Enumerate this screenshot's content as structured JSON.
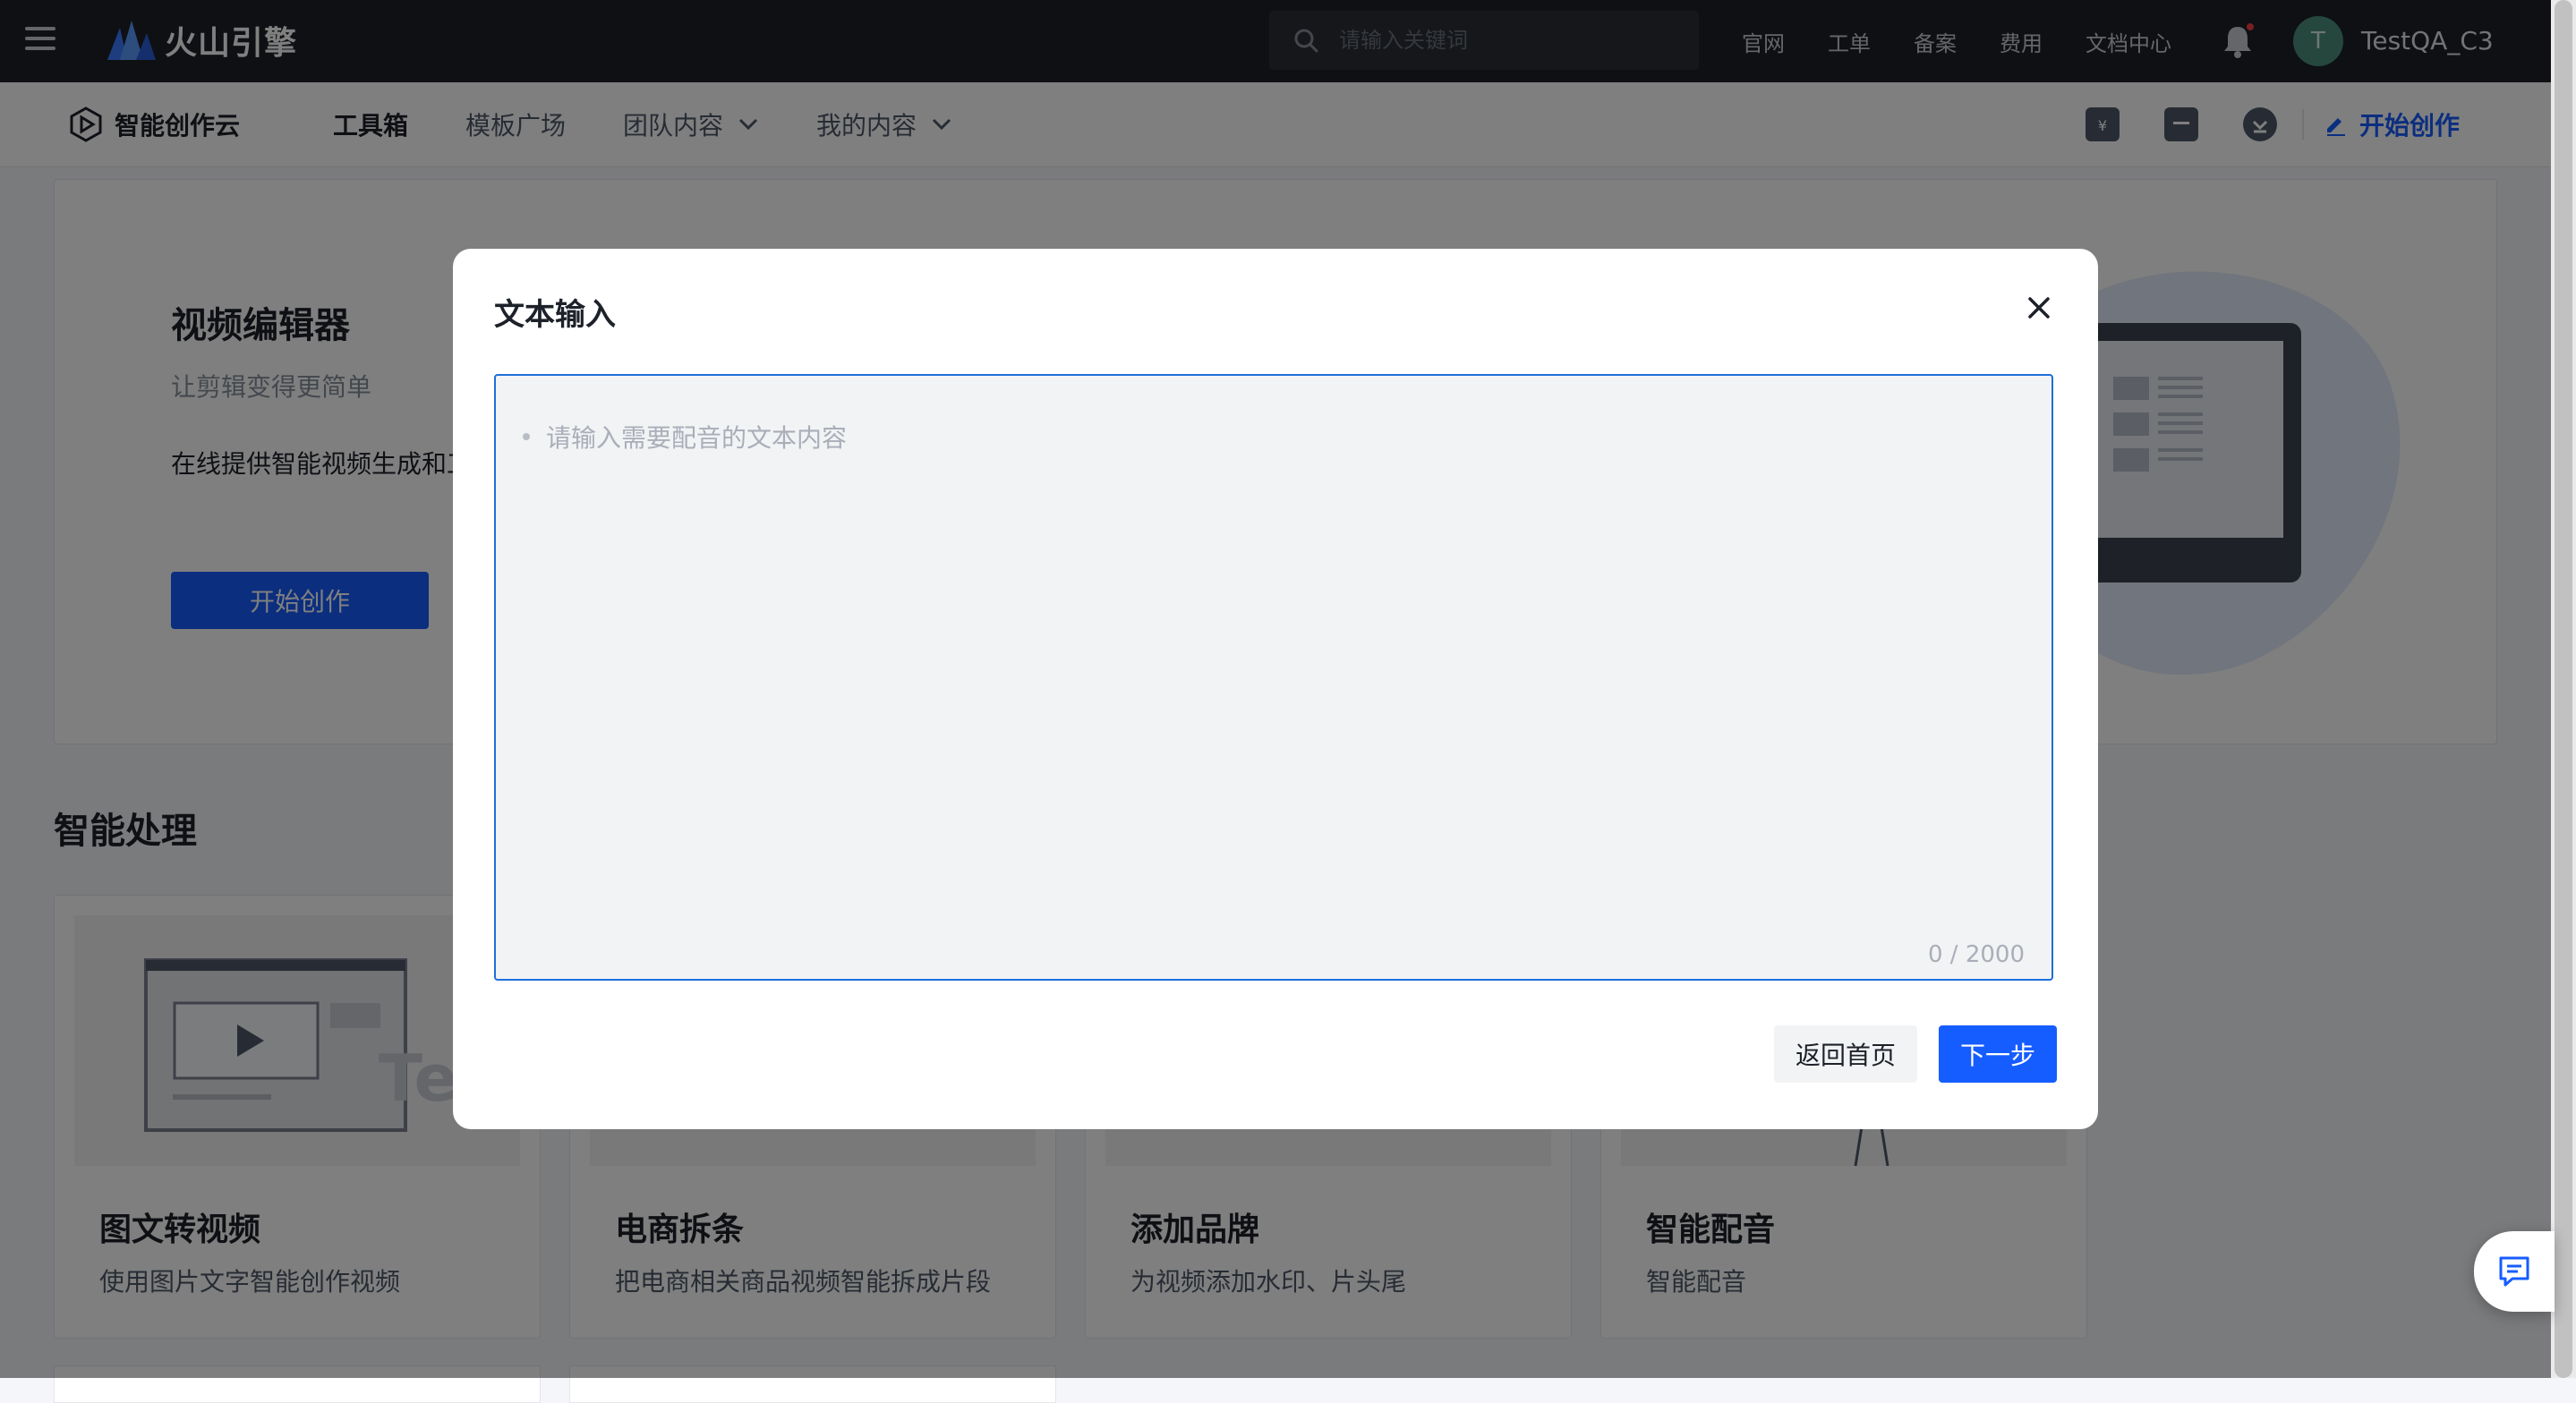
{
  "topbar": {
    "brand": "火山引擎",
    "search_placeholder": "请输入关键词",
    "links": [
      "官网",
      "工单",
      "备案",
      "费用",
      "文档中心"
    ],
    "avatar_initial": "T",
    "username": "TestQA_C3"
  },
  "subnav": {
    "product_name": "智能创作云",
    "tabs": [
      {
        "label": "工具箱",
        "active": true
      },
      {
        "label": "模板广场",
        "active": false
      },
      {
        "label": "团队内容",
        "active": false,
        "dropdown": true
      },
      {
        "label": "我的内容",
        "active": false,
        "dropdown": true
      }
    ],
    "start_label": "开始创作"
  },
  "hero": {
    "title": "视频编辑器",
    "subtitle": "让剪辑变得更简单",
    "description": "在线提供智能视频生成和工",
    "button": "开始创作"
  },
  "section": {
    "title": "智能处理",
    "cards": [
      {
        "title": "图文转视频",
        "desc": "使用图片文字智能创作视频",
        "thumb_text": "Tex"
      },
      {
        "title": "电商拆条",
        "desc": "把电商相关商品视频智能拆成片段"
      },
      {
        "title": "添加品牌",
        "desc": "为视频添加水印、片头尾"
      },
      {
        "title": "智能配音",
        "desc": "智能配音"
      }
    ]
  },
  "modal": {
    "title": "文本输入",
    "textarea_placeholder": "请输入需要配音的文本内容",
    "char_count": "0 / 2000",
    "back_button": "返回首页",
    "next_button": "下一步"
  },
  "colors": {
    "topbar_bg": "#1d2129",
    "primary": "#165dff",
    "textarea_border": "#1e6fd9",
    "overlay": "rgba(0,0,0,0.5)"
  },
  "icons": [
    "menu-icon",
    "logo-icon",
    "search-icon",
    "bell-icon",
    "product-logo-icon",
    "chevron-down-icon",
    "pricing-icon",
    "archive-icon",
    "download-icon",
    "edit-icon",
    "close-icon",
    "feedback-icon"
  ]
}
